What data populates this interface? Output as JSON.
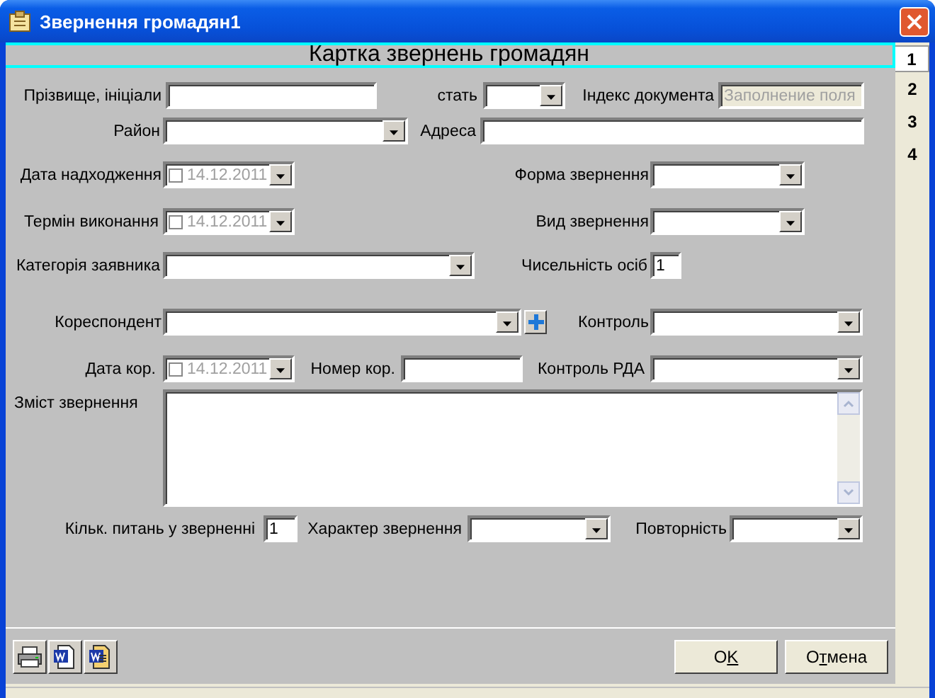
{
  "window": {
    "title": "Звернення громадян1"
  },
  "header": "Картка звернень громадян",
  "side_tabs": [
    {
      "label": "1",
      "selected": true
    },
    {
      "label": "2",
      "selected": false
    },
    {
      "label": "3",
      "selected": false
    },
    {
      "label": "4",
      "selected": false
    }
  ],
  "rows": [
    {
      "items": [
        {
          "kind": "text",
          "label": "Прізвище, ініціали"
        },
        {
          "kind": "combo",
          "label": "стать"
        },
        {
          "kind": "text",
          "label": "Індекс документа",
          "placeholder": "Заполнение поля",
          "disabled": true
        }
      ]
    },
    {
      "items": [
        {
          "kind": "combo",
          "label": "Район"
        },
        {
          "kind": "text",
          "label": "Адреса"
        }
      ]
    },
    {
      "items": [
        {
          "kind": "date",
          "label": "Дата надходження",
          "value": "14.12.2011",
          "checked": false,
          "disabled": true
        },
        {
          "kind": "combo",
          "label": "Форма звернення"
        }
      ]
    },
    {
      "items": [
        {
          "kind": "date",
          "label": "Термін виконання",
          "value": "14.12.2011",
          "checked": false,
          "disabled": true
        },
        {
          "kind": "combo",
          "label": "Вид звернення"
        }
      ]
    },
    {
      "items": [
        {
          "kind": "combo",
          "label": "Категорія заявника"
        },
        {
          "kind": "text",
          "label": "Чисельність осіб",
          "value": "1"
        }
      ]
    },
    {
      "items": [
        {
          "kind": "combo_add",
          "label": "Кореспондент"
        },
        {
          "kind": "combo",
          "label": "Контроль"
        }
      ]
    },
    {
      "items": [
        {
          "kind": "date",
          "label": "Дата кор.",
          "value": "14.12.2011",
          "checked": false,
          "disabled": true
        },
        {
          "kind": "text",
          "label": "Номер кор."
        },
        {
          "kind": "combo",
          "label": "Контроль РДА"
        }
      ]
    },
    {
      "items": [
        {
          "kind": "memo",
          "label": "Зміст звернення"
        }
      ]
    },
    {
      "items": [
        {
          "kind": "text",
          "label": "Кільк. питань у зверненні",
          "value": "1"
        },
        {
          "kind": "combo",
          "label": "Характер звернення"
        },
        {
          "kind": "combo",
          "label": "Повторність"
        }
      ]
    }
  ],
  "buttons": [
    {
      "parts": [
        "O",
        "K"
      ]
    },
    {
      "parts": [
        "О",
        "т",
        "мена"
      ]
    }
  ]
}
